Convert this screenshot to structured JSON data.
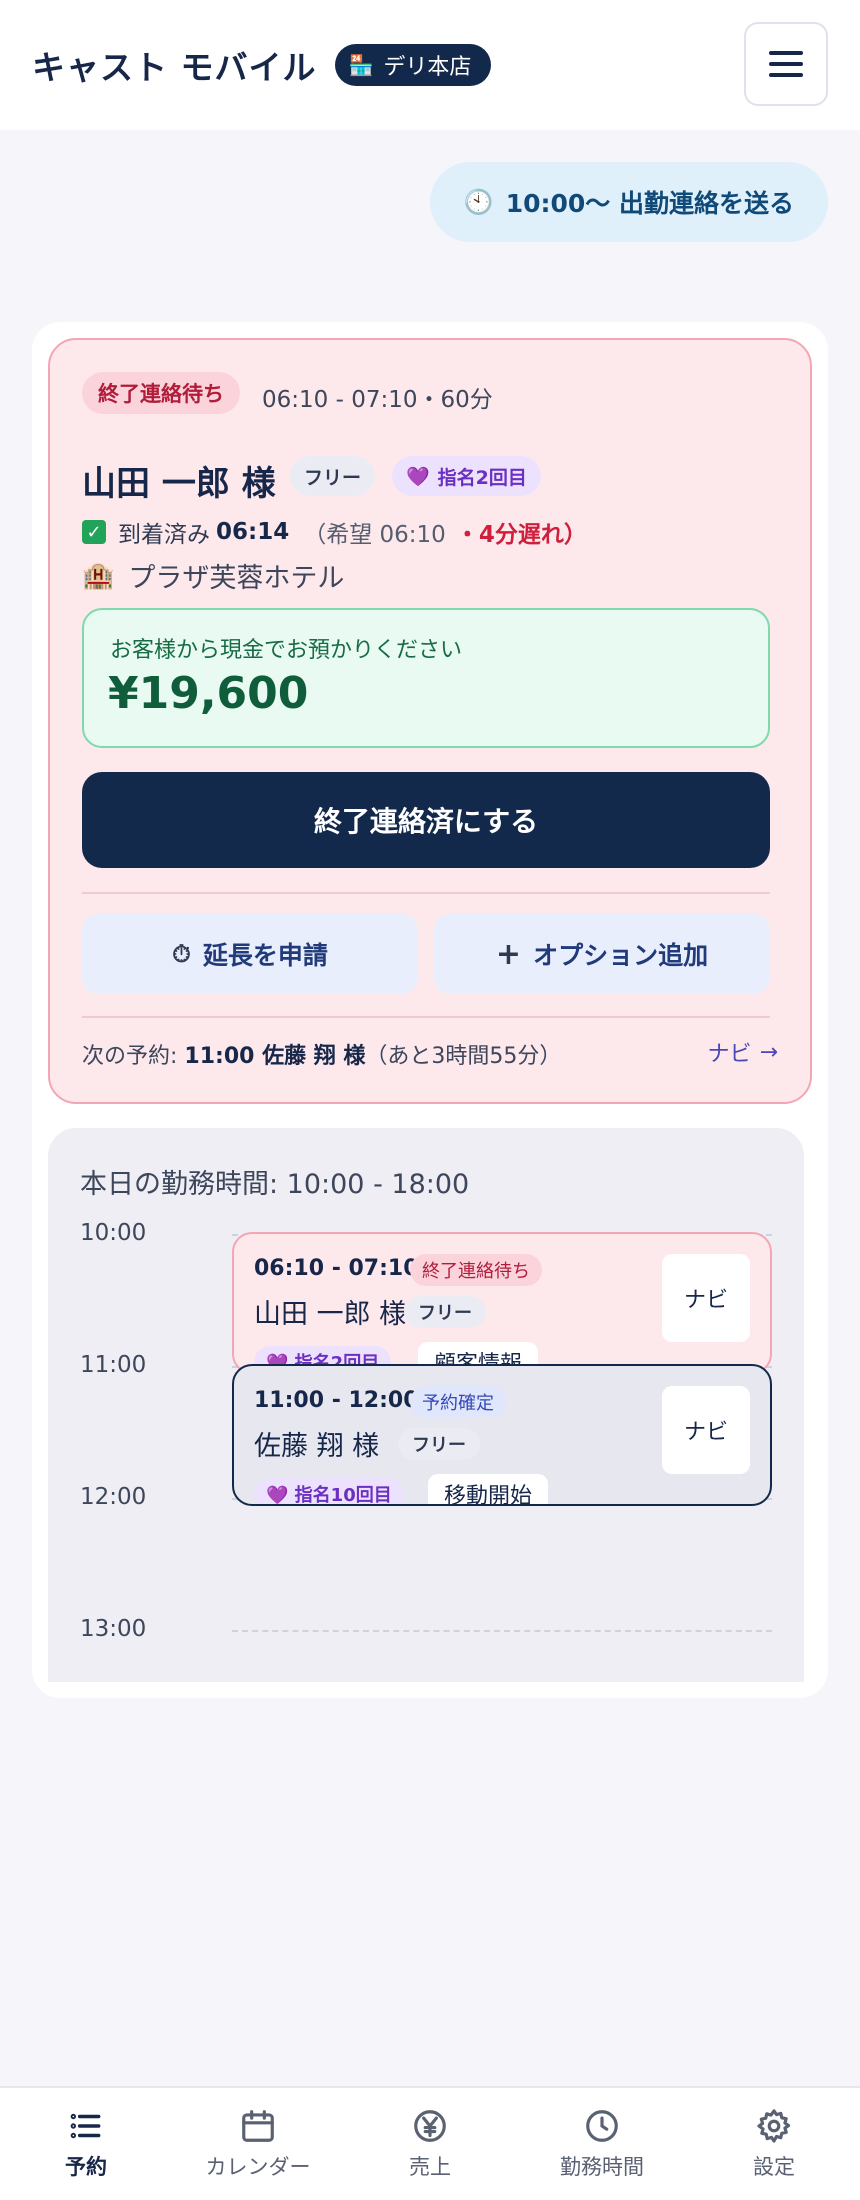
{
  "header": {
    "app_title": "キャスト モバイル",
    "store_badge_icon": "🏪",
    "store_name": "デリ本店"
  },
  "clock_report": {
    "icon": "🕙",
    "label": "10:00〜 出勤連絡を送る"
  },
  "current_booking": {
    "status": "終了連絡待ち",
    "time_range": "06:10 - 07:10・60分",
    "customer_name": "山田 一郎 様",
    "tag_free": "フリー",
    "nomination_icon": "💜",
    "tag_nomination": "指名2回目",
    "arrival_label": "到着済み",
    "arrival_time": "06:14",
    "desired_time": "（希望 06:10",
    "late_text": "・4分遅れ）",
    "hotel_icon": "🏨",
    "hotel": "プラザ芙蓉ホテル",
    "cash_label": "お客様から現金でお預かりください",
    "cash_amount": "¥19,600",
    "complete_button": "終了連絡済にする",
    "extend_icon": "⏱",
    "extend_button": "延長を申請",
    "option_icon": "+",
    "option_button": "オプション追加",
    "next_prefix": "次の予約: ",
    "next_booking": "11:00 佐藤 翔 様",
    "next_remaining": "（あと3時間55分）",
    "navi_link": "ナビ",
    "navi_arrow": "→"
  },
  "schedule": {
    "work_hours": "本日の勤務時間: 10:00 - 18:00",
    "hours": [
      "10:00",
      "11:00",
      "12:00",
      "13:00"
    ],
    "appointments": [
      {
        "time": "06:10 - 07:10",
        "status": "終了連絡待ち",
        "name": "山田 一郎 様",
        "tag_free": "フリー",
        "nomination": "💜 指名2回目",
        "action": "顧客情報",
        "navi": "ナビ"
      },
      {
        "time": "11:00 - 12:00",
        "status": "予約確定",
        "name": "佐藤 翔 様",
        "tag_free": "フリー",
        "nomination": "💜 指名10回目",
        "action": "移動開始",
        "navi": "ナビ"
      }
    ]
  },
  "bottom_nav": [
    {
      "label": "予約",
      "icon": "list-icon",
      "active": true
    },
    {
      "label": "カレンダー",
      "icon": "calendar-icon",
      "active": false
    },
    {
      "label": "売上",
      "icon": "yen-icon",
      "active": false
    },
    {
      "label": "勤務時間",
      "icon": "clock-icon",
      "active": false
    },
    {
      "label": "設定",
      "icon": "gear-icon",
      "active": false
    }
  ],
  "colors": {
    "navy": "#13294b",
    "pink_bg": "#fde9ec",
    "pink_border": "#f3a6b4",
    "alert_red": "#d01f3d",
    "green_bg": "#e8faf1",
    "purple": "#6b2fc2"
  }
}
